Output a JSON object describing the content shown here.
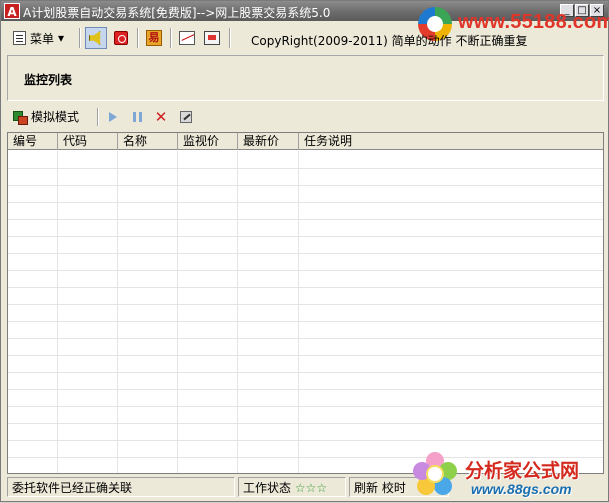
{
  "window": {
    "app_icon_letter": "A",
    "title": "A计划股票自动交易系统[免费版]-->网上股票交易系统5.0",
    "minimize_label": "_",
    "maximize_label": "□",
    "close_label": "×"
  },
  "watermark_top": {
    "url": "www.55188.com"
  },
  "toolbar": {
    "menu_label": "菜单",
    "menu_caret": "▾",
    "yang_icon_char": "易",
    "copyright": "CopyRight(2009-2011) 简单的动作 不断正确重复"
  },
  "panel": {
    "title": "监控列表"
  },
  "subtoolbar": {
    "mode_label": "模拟模式",
    "delete_glyph": "✕"
  },
  "grid": {
    "columns": [
      "编号",
      "代码",
      "名称",
      "监视价",
      "最新价",
      "任务说明"
    ],
    "rows": []
  },
  "statusbar": {
    "message": "委托软件已经正确关联",
    "work_state_label": "工作状态",
    "work_state_stars": "☆☆☆",
    "refresh_label": "刷新",
    "calibrate_label": "校时"
  },
  "watermark_bottom": {
    "title": "分析家公式网",
    "url": "www.88gs.com"
  },
  "colors": {
    "titlebar": "#6e6e6e",
    "window_bg": "#ece9d8",
    "watermark_red": "#e0352b",
    "watermark_blue": "#1a6fb0",
    "stars_green": "#2f9a2f"
  }
}
